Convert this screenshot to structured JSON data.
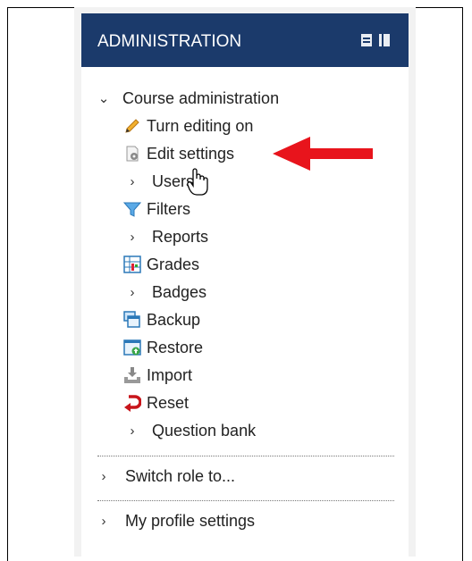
{
  "header": {
    "title": "ADMINISTRATION"
  },
  "course_admin": {
    "label": "Course administration",
    "items": [
      {
        "label": "Turn editing on",
        "icon": "pencil-icon"
      },
      {
        "label": "Edit settings",
        "icon": "settings-gear-icon"
      },
      {
        "label": "Users",
        "icon": "chevron-right-icon"
      },
      {
        "label": "Filters",
        "icon": "filter-funnel-icon"
      },
      {
        "label": "Reports",
        "icon": "chevron-right-icon"
      },
      {
        "label": "Grades",
        "icon": "grades-table-icon"
      },
      {
        "label": "Badges",
        "icon": "chevron-right-icon"
      },
      {
        "label": "Backup",
        "icon": "backup-windows-icon"
      },
      {
        "label": "Restore",
        "icon": "restore-window-icon"
      },
      {
        "label": "Import",
        "icon": "import-tray-icon"
      },
      {
        "label": "Reset",
        "icon": "reset-arrow-icon"
      },
      {
        "label": "Question bank",
        "icon": "chevron-right-icon"
      }
    ]
  },
  "switch_role": {
    "label": "Switch role to..."
  },
  "profile": {
    "label": "My profile settings"
  },
  "colors": {
    "header_bg": "#1b3a6b",
    "arrow": "#e8141c"
  }
}
